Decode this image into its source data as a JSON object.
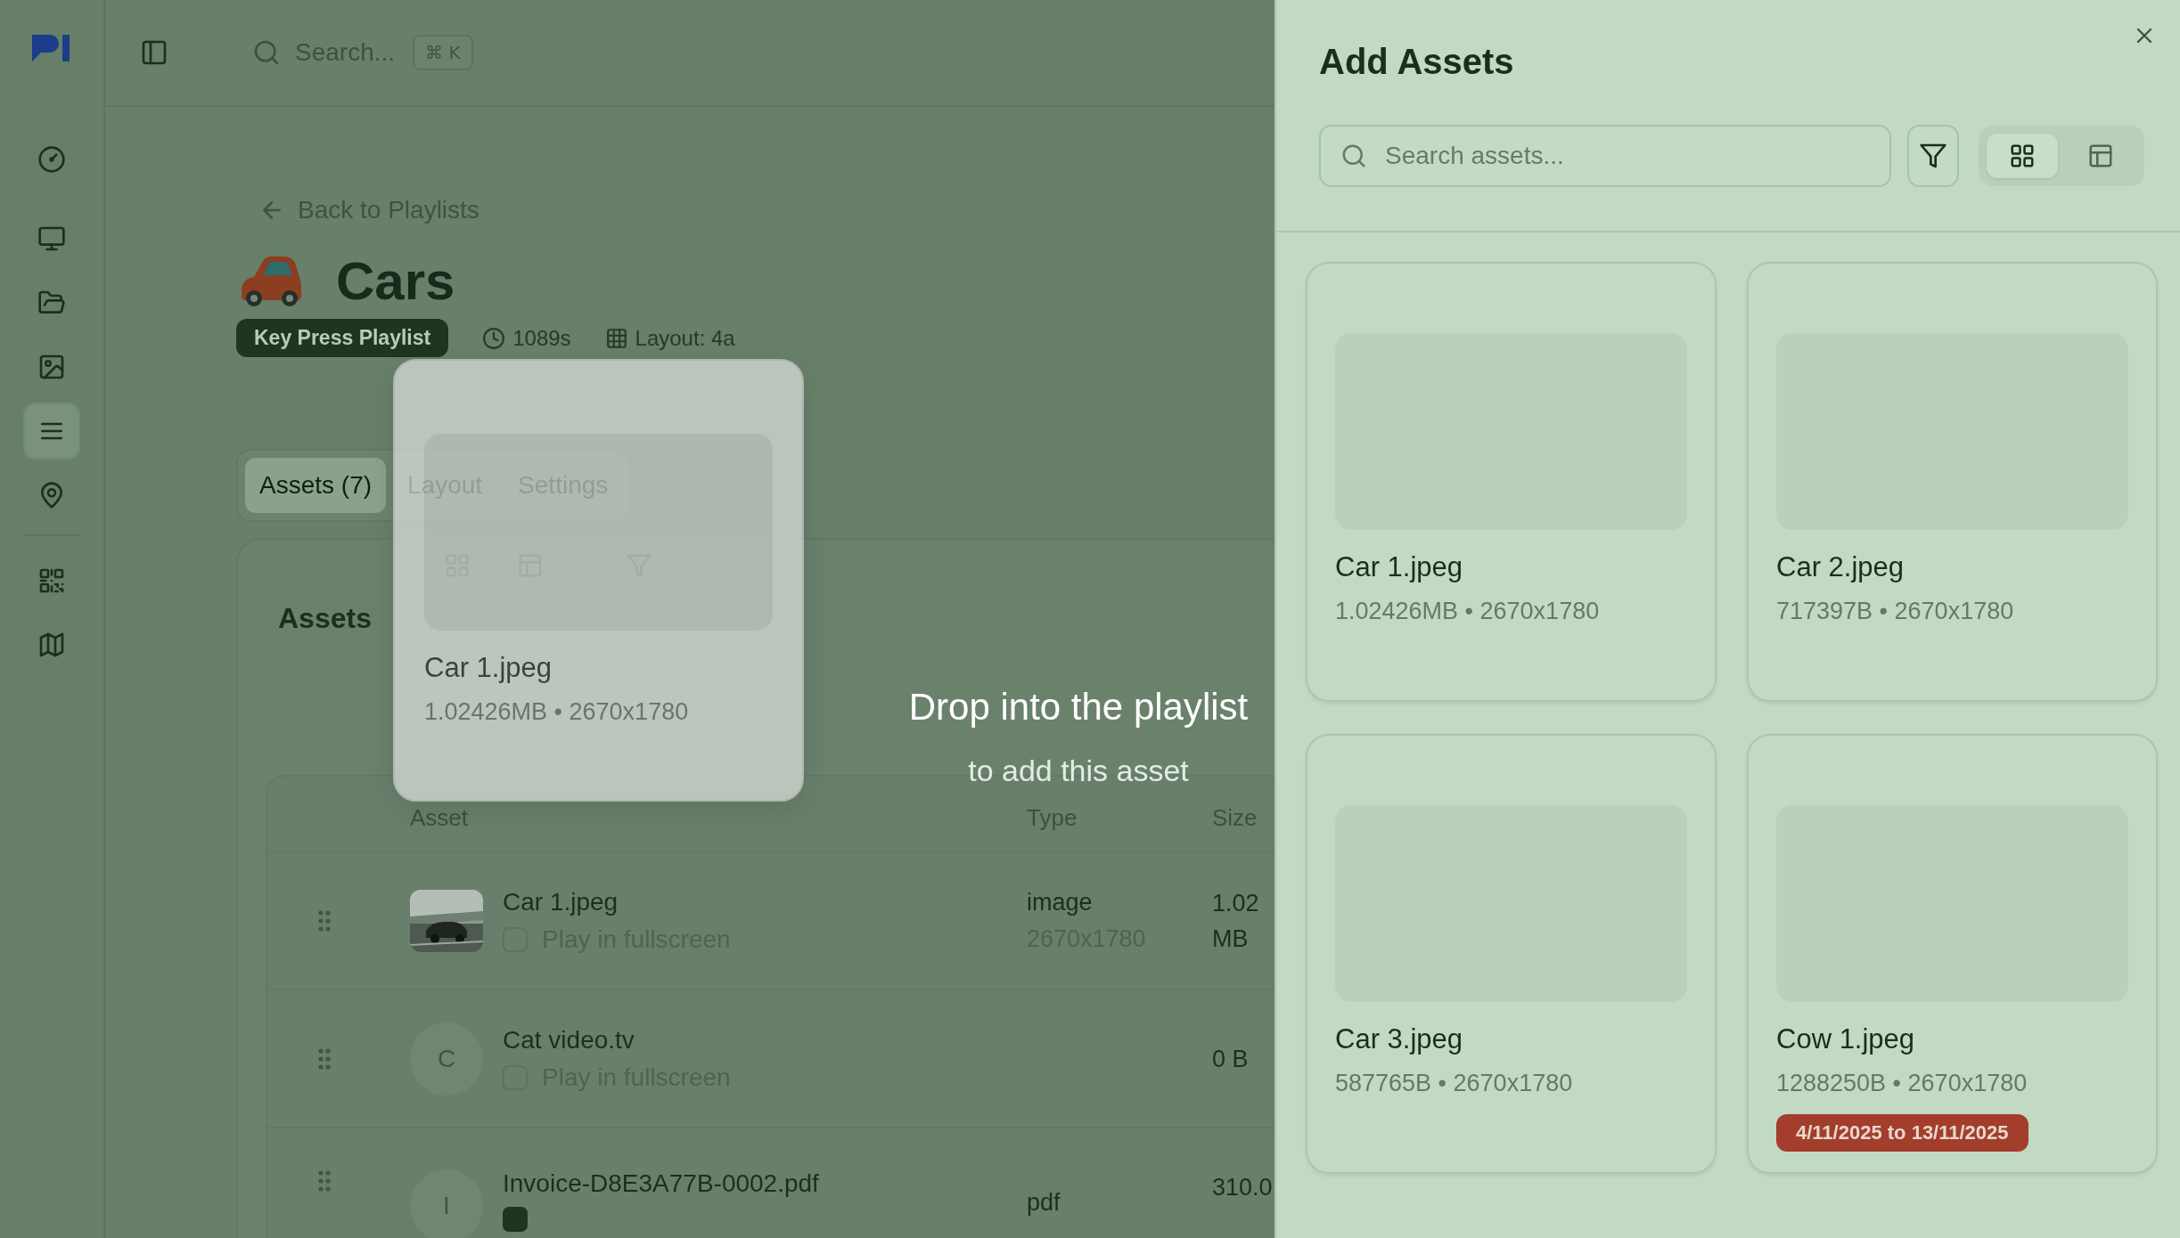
{
  "sidebar": {
    "sections": [
      {
        "items": [
          {
            "kind": "dashboard",
            "selected": false
          }
        ]
      },
      {
        "items": [
          {
            "kind": "screens",
            "selected": false
          },
          {
            "kind": "folders",
            "selected": false
          },
          {
            "kind": "images",
            "selected": false
          },
          {
            "kind": "playlists",
            "selected": true
          },
          {
            "kind": "locations",
            "selected": false
          }
        ]
      },
      {
        "items": [
          {
            "kind": "qr",
            "selected": false
          },
          {
            "kind": "map",
            "selected": false
          }
        ]
      }
    ]
  },
  "topbar": {
    "search": {
      "placeholder": "Search...",
      "shortcut": "⌘ K"
    }
  },
  "back_link": "Back to Playlists",
  "playlist": {
    "title": "Cars",
    "badges": [
      {
        "kind": "type",
        "text": "Key Press Playlist"
      },
      {
        "kind": "duration",
        "text": "1089s"
      },
      {
        "kind": "layout",
        "text": "Layout: 4a"
      }
    ]
  },
  "tabs": [
    {
      "label": "Assets (7)",
      "selected": true
    },
    {
      "label": "Layout",
      "selected": false
    },
    {
      "label": "Settings",
      "selected": false
    }
  ],
  "assets_section": {
    "title": "Assets",
    "columns": [
      "Asset",
      "Type",
      "Size"
    ],
    "rows": [
      {
        "name": "Car 1.jpeg",
        "fullscreen": false,
        "fullscreen_label": "Play in fullscreen",
        "type": "image",
        "dimensions": "2670x1780",
        "size": "1.02 MB"
      },
      {
        "name": "Cat video.tv",
        "thumbnail": {
          "kind": "initial",
          "text": "C"
        },
        "fullscreen": false,
        "fullscreen_label": "Play in fullscreen",
        "size": "0 B"
      },
      {
        "name": "Invoice-D8E3A77B-0002.pdf",
        "thumbnail": {
          "kind": "initial",
          "text": "I"
        },
        "fullscreen": true,
        "type": "pdf",
        "size": "310.0"
      }
    ]
  },
  "drag_preview": {
    "name": "Car 1.jpeg",
    "meta": "1.02426MB • 2670x1780"
  },
  "drop_hint": {
    "title": "Drop into the playlist",
    "subtitle": "to add this asset"
  },
  "panel": {
    "title": "Add Assets",
    "search": {
      "placeholder": "Search assets..."
    },
    "views": [
      {
        "kind": "grid",
        "selected": true
      },
      {
        "kind": "table",
        "selected": false
      }
    ],
    "assets": [
      {
        "name": "Car 1.jpeg",
        "meta": "1.02426MB • 2670x1780"
      },
      {
        "name": "Car 2.jpeg",
        "meta": "717397B • 2670x1780"
      },
      {
        "name": "Car 3.jpeg",
        "meta": "587765B • 2670x1780"
      },
      {
        "name": "Cow 1.jpeg",
        "meta": "1288250B • 2670x1780",
        "schedule": "4/11/2025 to 13/11/2025"
      }
    ]
  }
}
